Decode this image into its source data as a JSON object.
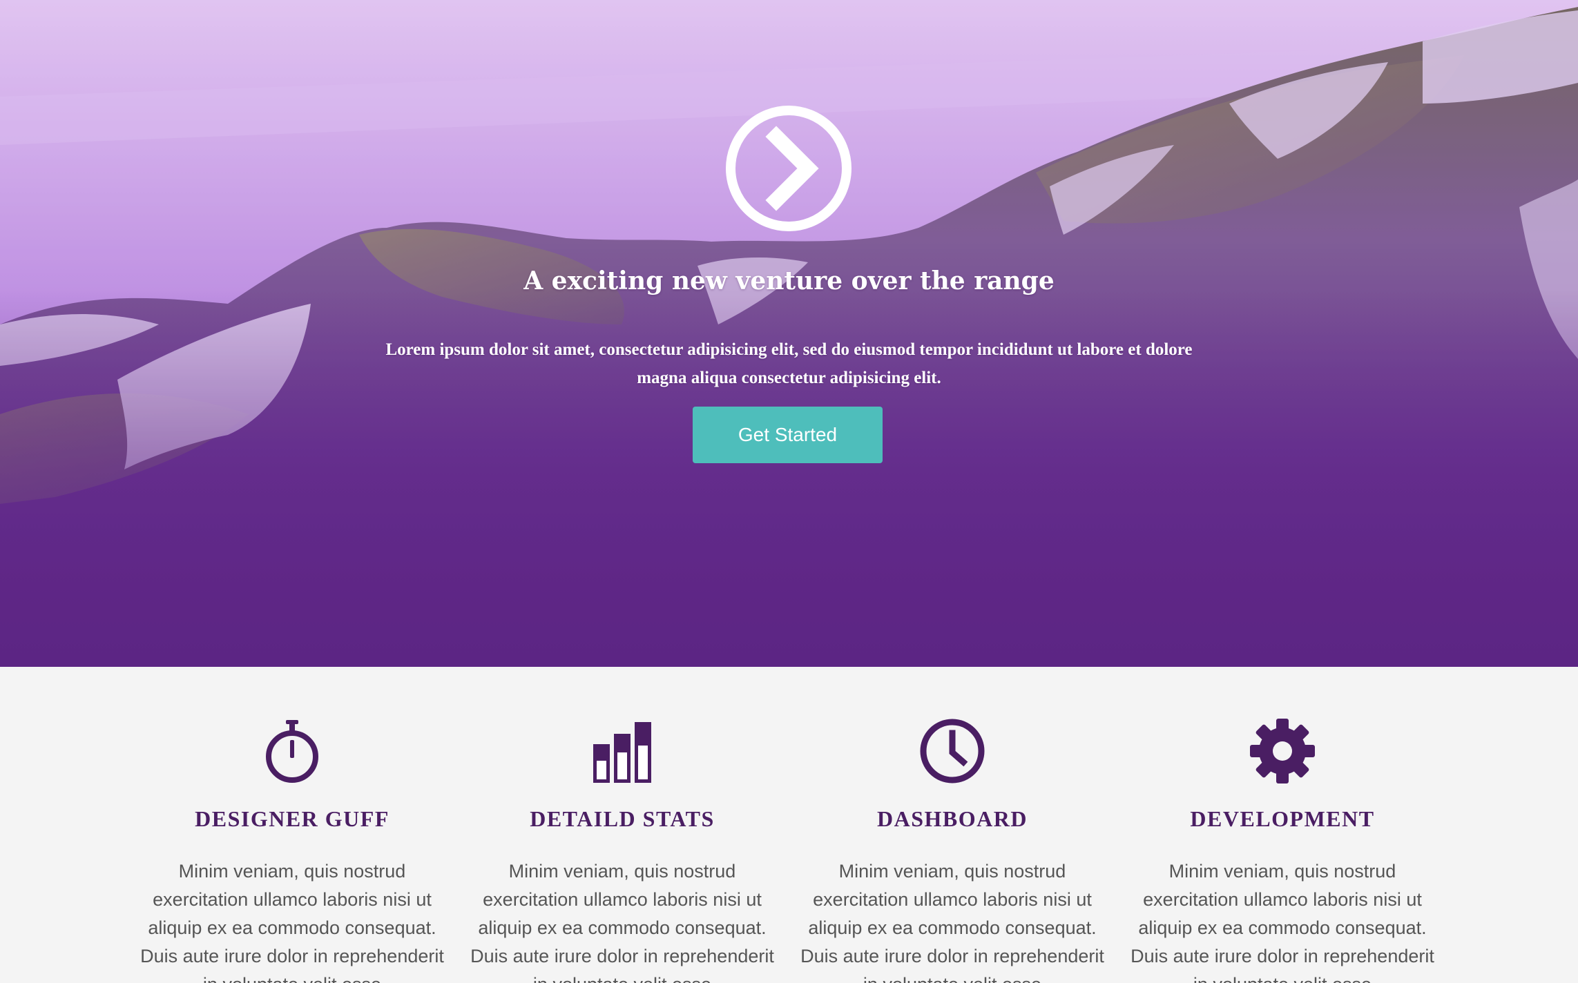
{
  "hero": {
    "title": "A exciting new venture over the range",
    "text": "Lorem ipsum dolor sit amet, consectetur adipisicing elit, sed do eiusmod tempor incididunt ut labore et dolore magna aliqua consectetur adipisicing elit.",
    "button_label": "Get Started",
    "icon": "chevron-right-circle-icon",
    "button_color": "#4ebebb",
    "overlay_color": "#521c76"
  },
  "features": [
    {
      "icon": "stopwatch-icon",
      "title": "DESIGNER GUFF",
      "text": "Minim veniam, quis nostrud exercitation ullamco laboris nisi ut aliquip ex ea commodo consequat. Duis aute irure dolor in reprehenderit in voluptate velit esse"
    },
    {
      "icon": "bar-chart-icon",
      "title": "DETAILD STATS",
      "text": "Minim veniam, quis nostrud exercitation ullamco laboris nisi ut aliquip ex ea commodo consequat. Duis aute irure dolor in reprehenderit in voluptate velit esse"
    },
    {
      "icon": "clock-icon",
      "title": "DASHBOARD",
      "text": "Minim veniam, quis nostrud exercitation ullamco laboris nisi ut aliquip ex ea commodo consequat. Duis aute irure dolor in reprehenderit in voluptate velit esse"
    },
    {
      "icon": "gear-icon",
      "title": "DEVELOPMENT",
      "text": "Minim veniam, quis nostrud exercitation ullamco laboris nisi ut aliquip ex ea commodo consequat. Duis aute irure dolor in reprehenderit in voluptate velit esse"
    }
  ],
  "colors": {
    "accent": "#4a1e63",
    "body_text": "#555555",
    "section_bg": "#f4f4f4"
  }
}
